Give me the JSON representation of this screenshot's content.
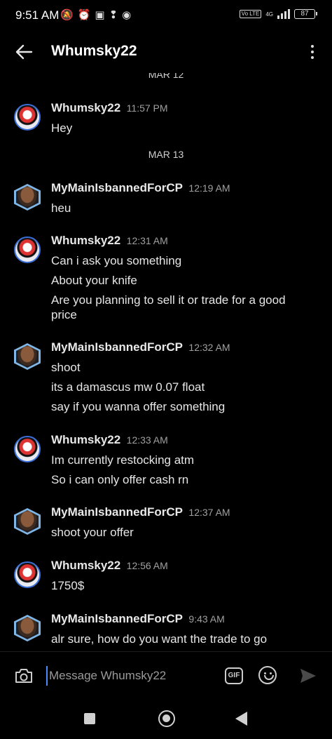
{
  "status": {
    "time": "9:51 AM",
    "network": "4G",
    "volte": "Vo LTE",
    "battery": "87"
  },
  "header": {
    "title": "Whumsky22"
  },
  "messages": {
    "date_partial": "MAR 12",
    "date_mar13": "MAR 13",
    "groups": [
      {
        "author": "Whumsky22",
        "time": "11:57 PM",
        "lines": [
          "Hey"
        ]
      },
      {
        "author": "MyMainIsbannedForCP",
        "time": "12:19 AM",
        "lines": [
          "heu"
        ]
      },
      {
        "author": "Whumsky22",
        "time": "12:31 AM",
        "lines": [
          "Can i ask you something",
          "About your knife",
          "Are you planning to sell it or trade for a good price"
        ]
      },
      {
        "author": "MyMainIsbannedForCP",
        "time": "12:32 AM",
        "lines": [
          "shoot",
          "its a damascus mw 0.07 float",
          "say if you wanna offer something"
        ]
      },
      {
        "author": "Whumsky22",
        "time": "12:33 AM",
        "lines": [
          "Im currently restocking atm",
          "So i can only offer cash rn"
        ]
      },
      {
        "author": "MyMainIsbannedForCP",
        "time": "12:37 AM",
        "lines": [
          "shoot your offer"
        ]
      },
      {
        "author": "Whumsky22",
        "time": "12:56 AM",
        "lines": [
          "1750$"
        ]
      },
      {
        "author": "MyMainIsbannedForCP",
        "time": "9:43 AM",
        "lines": [
          "alr sure, how do you want the trade to go"
        ]
      }
    ]
  },
  "composer": {
    "placeholder": "Message Whumsky22",
    "gif_label": "GIF"
  }
}
